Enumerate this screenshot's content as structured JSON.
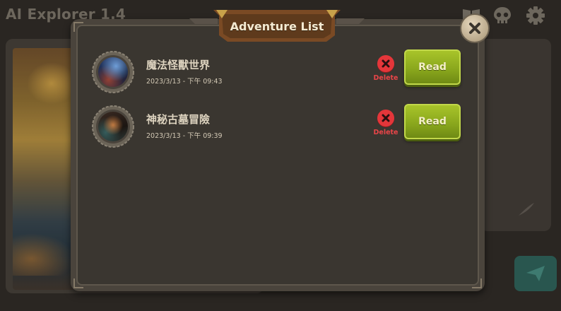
{
  "app": {
    "title": "AI Explorer 1.4"
  },
  "top_icons": [
    "book-icon",
    "skull-icon",
    "gear-icon"
  ],
  "dialog": {
    "title": "Adventure List",
    "close_icon": "close-icon",
    "items": [
      {
        "title": "魔法怪獸世界",
        "date": "2023/3/13 - 下午 09:43",
        "delete_label": "Delete",
        "read_label": "Read"
      },
      {
        "title": "神秘古墓冒險",
        "date": "2023/3/13 - 下午 09:39",
        "delete_label": "Delete",
        "read_label": "Read"
      }
    ]
  },
  "colors": {
    "read_button": "#88a51c",
    "delete_red": "#e4363a",
    "send_button": "#29564f"
  }
}
